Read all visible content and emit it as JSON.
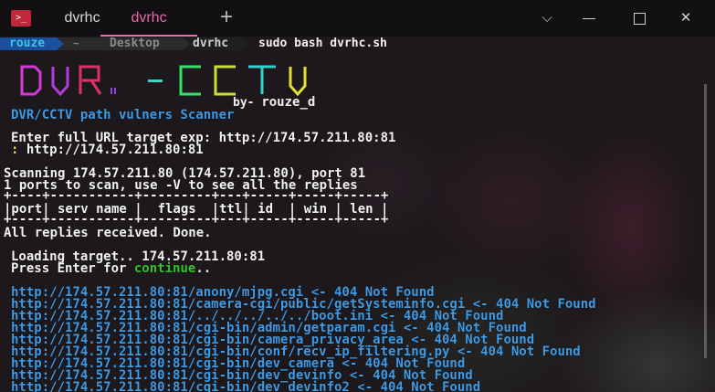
{
  "titlebar": {
    "tabs": [
      {
        "label": "dvrhc",
        "active": false
      },
      {
        "label": "dvrhc",
        "active": true
      }
    ],
    "new_tab": "+",
    "dropdown": "⌵",
    "close": "✕",
    "accent": "#e86aa8"
  },
  "prompt": {
    "user": "rouze",
    "home_symbol": "~",
    "path": "Desktop",
    "dir": "dvrhc",
    "command": "sudo bash dvrhc.sh"
  },
  "banner": {
    "letters": [
      "D",
      "V",
      "R",
      "-",
      "C",
      "C",
      "T",
      "V"
    ],
    "credit_prefix": "by-",
    "credit_name": "rouze_d"
  },
  "output": {
    "subtitle": "DVR/CCTV path vulners Scanner",
    "target_prompt": "Enter full URL target exp: http://174.57.211.80:81",
    "target_input_marker": ":",
    "target_input": "http://174.57.211.80:81",
    "scanning": "Scanning 174.57.211.80 (174.57.211.80), port 81",
    "ports_info": "1 ports to scan, use -V to see all the replies",
    "table_border": "+----+-----------+---------+---+-----+-----+-----+",
    "table_header": "|port| serv name |  flags  |ttl| id  | win | len |",
    "replies": "All replies received. Done.",
    "loading": "Loading target.. 174.57.211.80:81",
    "press_prefix": "Press Enter for",
    "press_word": "continue",
    "press_suffix": "..",
    "results": [
      "http://174.57.211.80:81/anony/mjpg.cgi <- 404 Not Found",
      "http://174.57.211.80:81/camera-cgi/public/getSysteminfo.cgi <- 404 Not Found",
      "http://174.57.211.80:81/../../../../../boot.ini <- 404 Not Found",
      "http://174.57.211.80:81/cgi-bin/admin/getparam.cgi <- 404 Not Found",
      "http://174.57.211.80:81/cgi-bin/camera_privacy_area <- 404 Not Found",
      "http://174.57.211.80:81/cgi-bin/conf/recv_ip_filtering.py <- 404 Not Found",
      "http://174.57.211.80:81/cgi-bin/dev_camera <- 404 Not Found",
      "http://174.57.211.80:81/cgi-bin/dev_devinfo <- 404 Not Found",
      "http://174.57.211.80:81/cgi-bin/dev_devinfo2 <- 404 Not Found"
    ]
  },
  "colors": {
    "link_blue": "#3e9be6",
    "continue_green": "#37c22d",
    "banner": [
      "#d63ad6",
      "#b23ae0",
      "#e0306a",
      "#38d9c4",
      "#38e06a",
      "#c6e038",
      "#2fd1d1",
      "#e0e038"
    ]
  }
}
